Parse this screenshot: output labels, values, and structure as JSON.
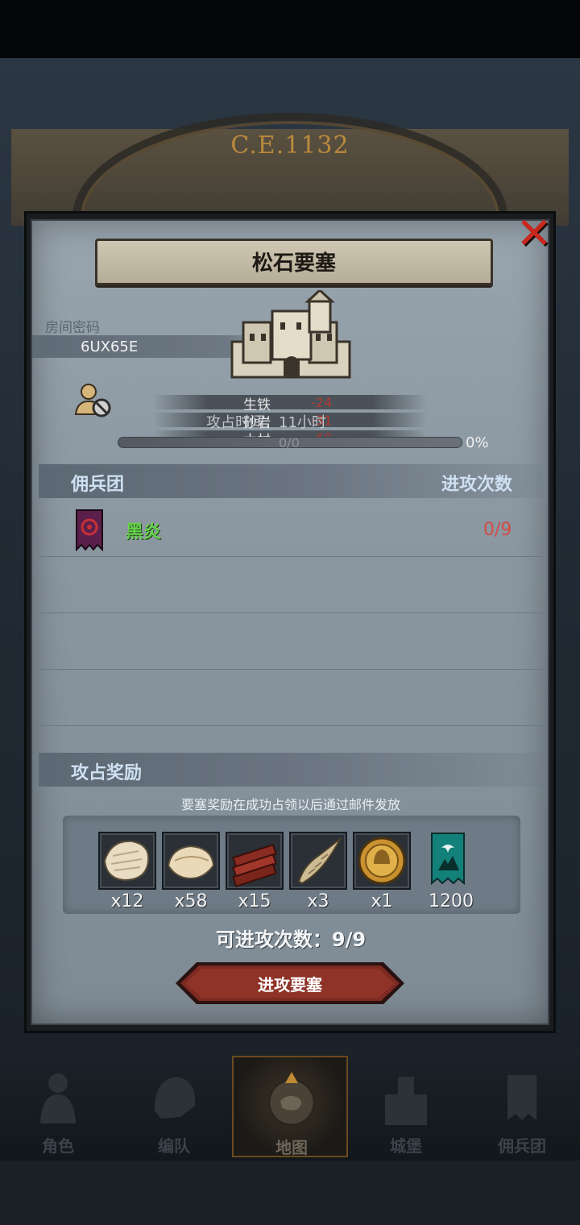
{
  "background": {
    "era_label": "C.E.1132"
  },
  "dialog": {
    "title": "松石要塞",
    "room": {
      "label": "房间密码",
      "code": "6UX65E"
    },
    "resources": [
      {
        "name": "生铁",
        "value": "-24"
      },
      {
        "name": "砂岩",
        "value": "-31"
      },
      {
        "name": "木材",
        "value": "-60"
      }
    ],
    "attack_time": "攻占时间：11小时",
    "progress": {
      "fraction_text": "0/0",
      "percent_text": "0%",
      "value": 0
    },
    "mercenary_section": {
      "left_header": "佣兵团",
      "right_header": "进攻次数"
    },
    "guilds": [
      {
        "name": "黑炎",
        "attacks": "0/9",
        "name_color": "#67d34b",
        "count_color": "#d24b45"
      }
    ],
    "reward_section": {
      "header": "攻占奖励",
      "note": "要塞奖励在成功占领以后通过邮件发放"
    },
    "rewards": [
      {
        "icon": "fur-pelt-icon",
        "qty": "x12"
      },
      {
        "icon": "cloth-bundle-icon",
        "qty": "x58"
      },
      {
        "icon": "wood-planks-icon",
        "qty": "x15"
      },
      {
        "icon": "horn-icon",
        "qty": "x3"
      },
      {
        "icon": "gold-medal-icon",
        "qty": "x1"
      },
      {
        "icon": "guild-banner-icon",
        "qty": "1200"
      }
    ],
    "attempts_text": "可进攻次数：9/9",
    "attack_button": "进攻要塞"
  },
  "nav": [
    {
      "label": "角色",
      "icon": "knight-icon"
    },
    {
      "label": "编队",
      "icon": "helmet-icon"
    },
    {
      "label": "地图",
      "icon": "map-compass-icon",
      "active": true
    },
    {
      "label": "城堡",
      "icon": "castle-icon"
    },
    {
      "label": "佣兵团",
      "icon": "mercenary-flag-icon"
    }
  ],
  "colors": {
    "accent_red": "#c8281e",
    "guild_green": "#67d34b",
    "title_plate": "#cfc7b3"
  }
}
